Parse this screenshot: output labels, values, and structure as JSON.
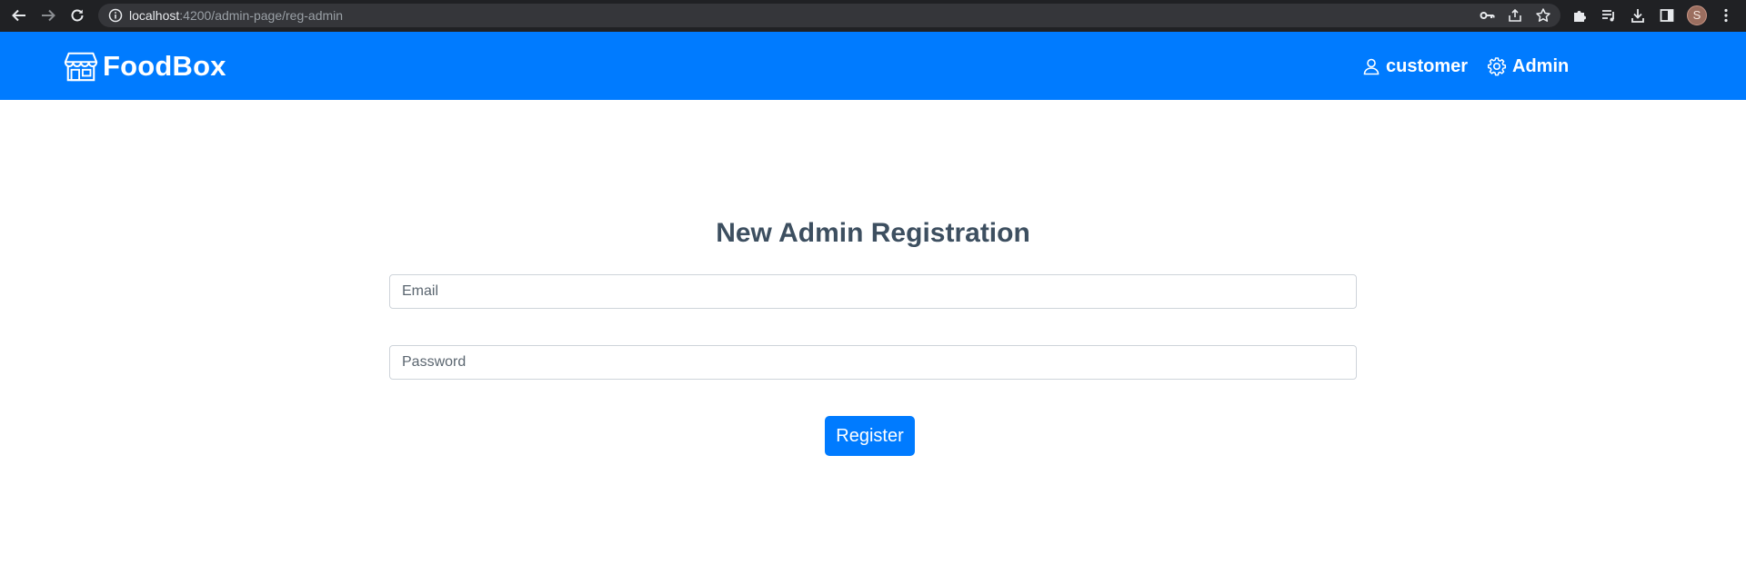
{
  "browser": {
    "url_host": "localhost",
    "url_path": ":4200/admin-page/reg-admin",
    "profile_initial": "S",
    "icons": [
      "back-icon",
      "forward-icon",
      "reload-icon",
      "site-info-icon",
      "key-icon",
      "share-icon",
      "star-icon",
      "extensions-icon",
      "media-icon",
      "download-icon",
      "side-panel-icon",
      "more-icon"
    ]
  },
  "navbar": {
    "brand": "FoodBox",
    "brand_icon": "shop-icon",
    "links": [
      {
        "label": "customer",
        "icon": "person-icon"
      },
      {
        "label": "Admin",
        "icon": "gear-icon"
      }
    ],
    "color": "#007bff"
  },
  "form": {
    "title": "New Admin Registration",
    "email_placeholder": "Email",
    "email_value": "",
    "password_placeholder": "Password",
    "password_value": "",
    "submit_label": "Register"
  }
}
